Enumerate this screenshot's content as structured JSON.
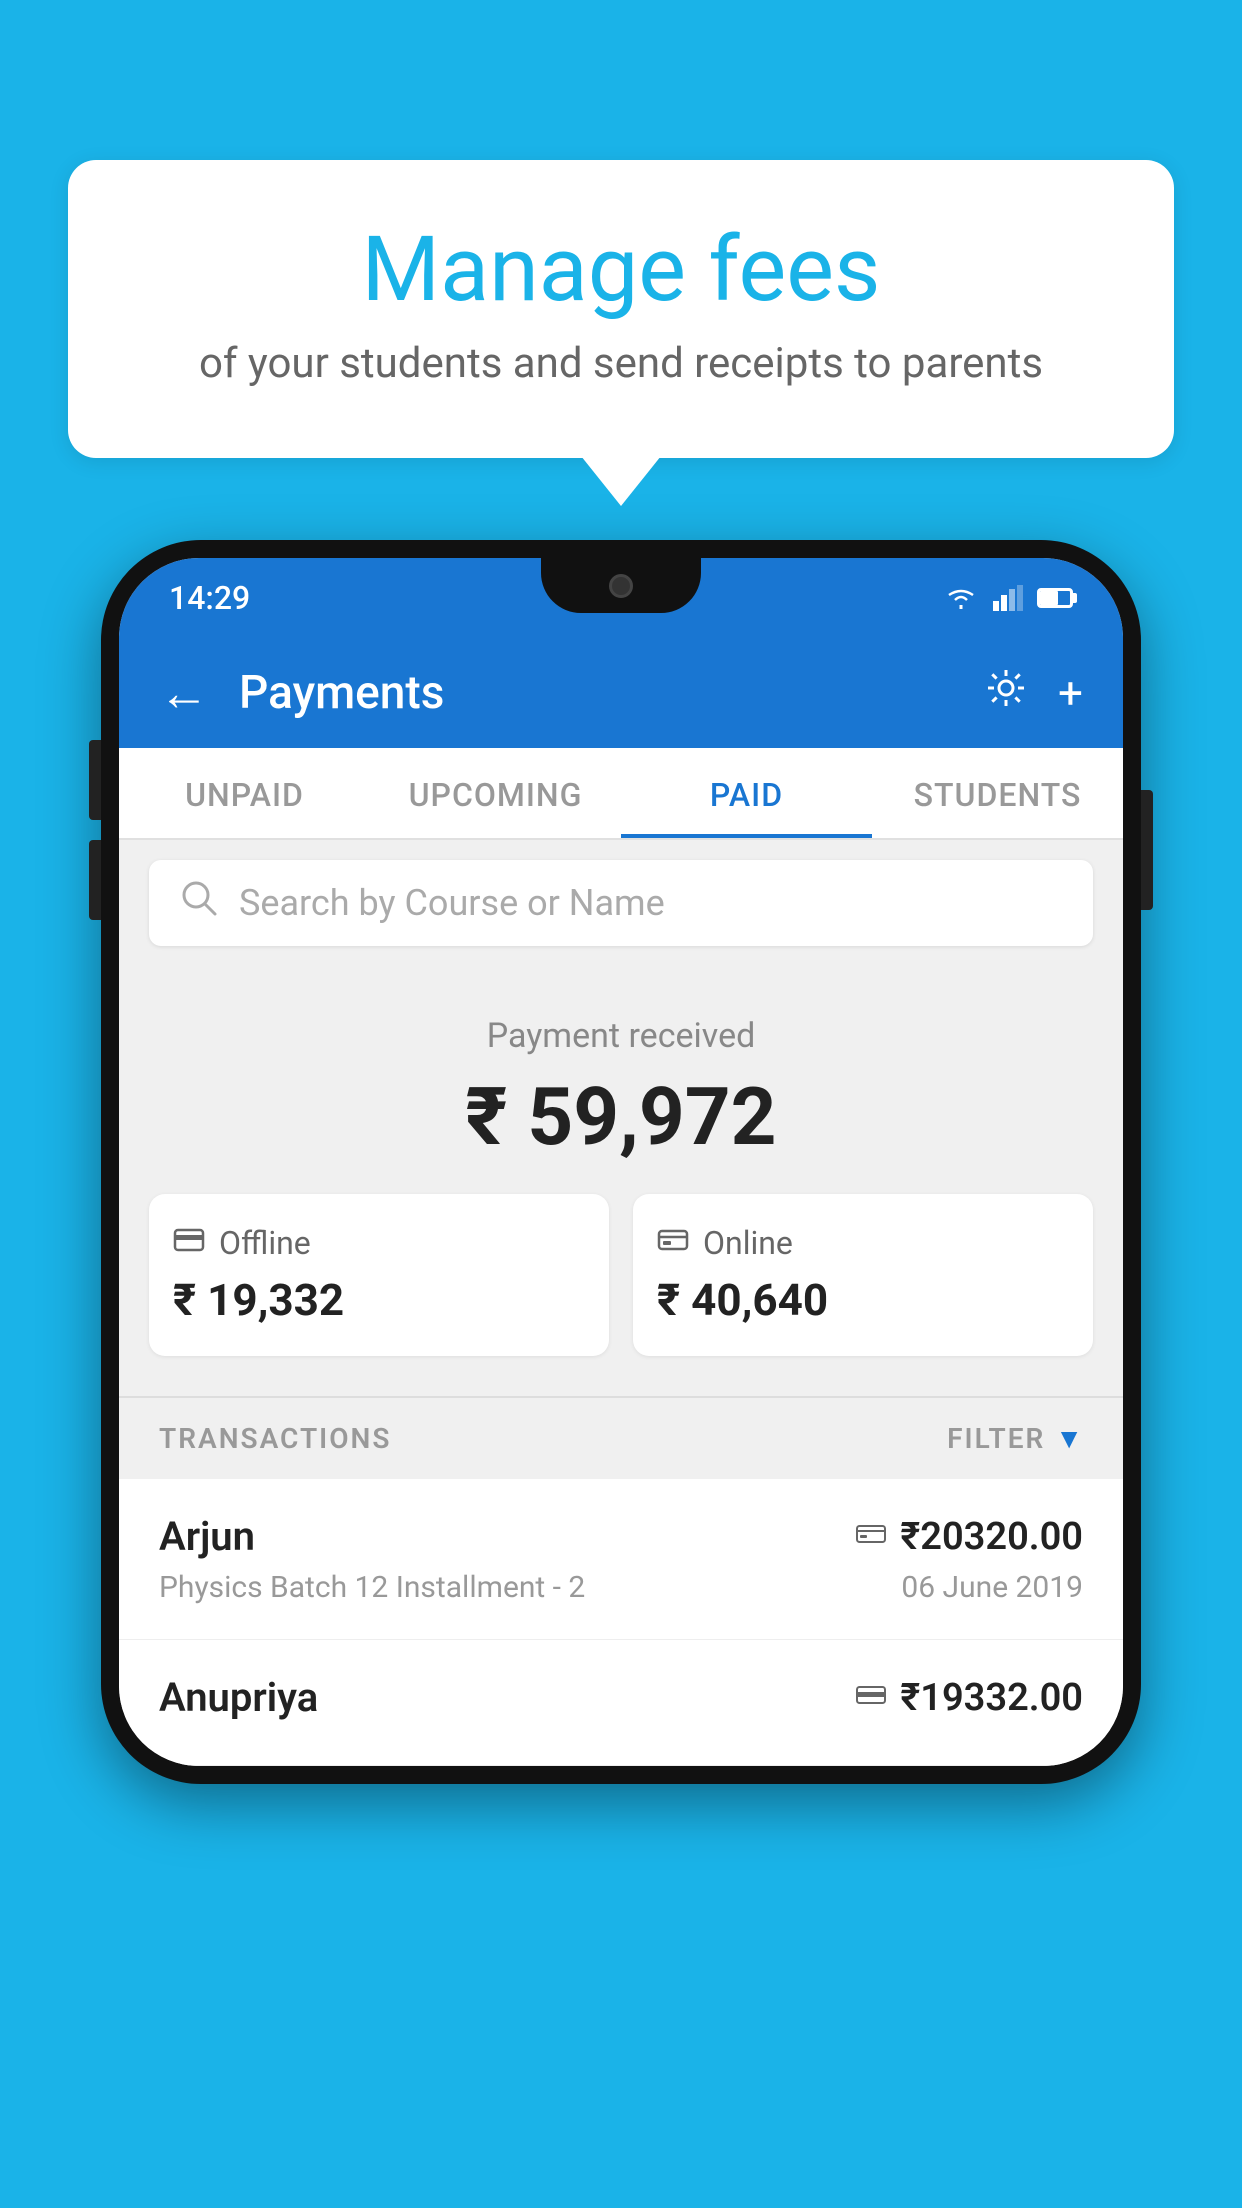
{
  "background": {
    "color": "#1ab3e8"
  },
  "speech_bubble": {
    "title": "Manage fees",
    "subtitle": "of your students and send receipts to parents"
  },
  "phone": {
    "status_bar": {
      "time": "14:29"
    },
    "header": {
      "title": "Payments",
      "back_label": "←",
      "settings_icon": "gear",
      "add_icon": "+"
    },
    "tabs": [
      {
        "label": "UNPAID",
        "active": false
      },
      {
        "label": "UPCOMING",
        "active": false
      },
      {
        "label": "PAID",
        "active": true
      },
      {
        "label": "STUDENTS",
        "active": false
      }
    ],
    "search": {
      "placeholder": "Search by Course or Name"
    },
    "payment_summary": {
      "label": "Payment received",
      "amount": "₹ 59,972",
      "offline": {
        "type": "Offline",
        "amount": "₹ 19,332"
      },
      "online": {
        "type": "Online",
        "amount": "₹ 40,640"
      }
    },
    "transactions": {
      "header": "TRANSACTIONS",
      "filter_label": "FILTER",
      "items": [
        {
          "name": "Arjun",
          "description": "Physics Batch 12 Installment - 2",
          "amount": "₹20320.00",
          "date": "06 June 2019",
          "payment_type": "online"
        },
        {
          "name": "Anupriya",
          "description": "",
          "amount": "₹19332.00",
          "date": "",
          "payment_type": "offline"
        }
      ]
    }
  }
}
